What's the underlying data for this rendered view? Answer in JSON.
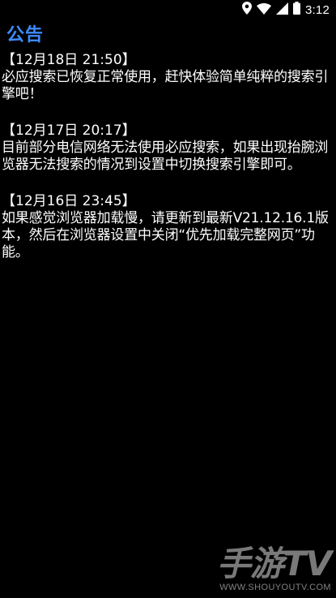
{
  "status_bar": {
    "time": "3:12",
    "icons": [
      "location-icon",
      "wifi-icon",
      "signal-icon",
      "battery-icon"
    ]
  },
  "page": {
    "title": "公告",
    "accent_color": "#3d8bff"
  },
  "notices": [
    {
      "date": "【12月18日 21:50】",
      "text": "必应搜索已恢复正常使用，赶快体验简单纯粹的搜索引擎吧！"
    },
    {
      "date": "【12月17日 20:17】",
      "text": "目前部分电信网络无法使用必应搜索，如果出现抬腕浏览器无法搜索的情况到设置中切换搜索引擎即可。"
    },
    {
      "date": "【12月16日 23:45】",
      "text": "如果感觉浏览器加载慢，请更新到最新V21.12.16.1版本，然后在浏览器设置中关闭“优先加载完整网页”功能。"
    }
  ],
  "watermark": {
    "main": "手游TV",
    "url": "WWW.SHOUYOUTV.COM"
  }
}
